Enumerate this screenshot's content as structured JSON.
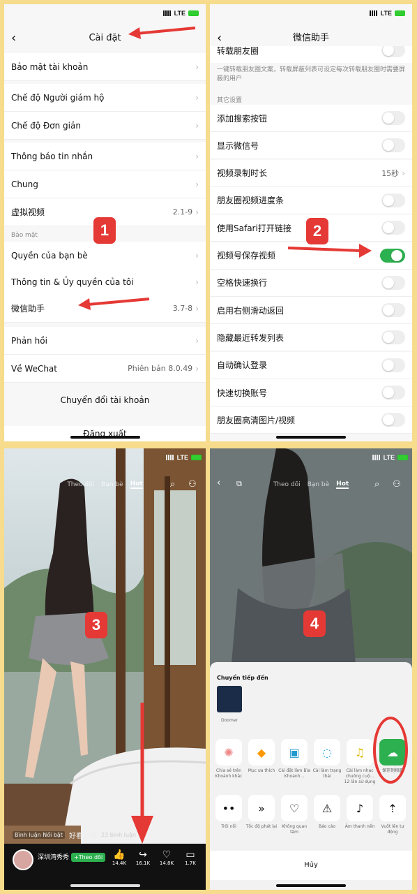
{
  "status": {
    "network": "LTE"
  },
  "panel1": {
    "title": "Cài đặt",
    "rows": [
      {
        "label": "Bảo mật tài khoản",
        "value": ""
      },
      {
        "label": "Chế độ Người giám hộ",
        "value": ""
      },
      {
        "label": "Chế độ Đơn giản",
        "value": ""
      },
      {
        "label": "Thông báo tin nhắn",
        "value": ""
      },
      {
        "label": "Chung",
        "value": ""
      },
      {
        "label": "虚拟视频",
        "value": "2.1-9"
      }
    ],
    "section": "Bảo mật",
    "rows2": [
      {
        "label": "Quyền của bạn bè",
        "value": ""
      },
      {
        "label": "Thông tin & Ủy quyền của tôi",
        "value": ""
      },
      {
        "label": "微信助手",
        "value": "3.7-8"
      },
      {
        "label": "Phản hồi",
        "value": ""
      },
      {
        "label": "Về WeChat",
        "value": "Phiên bản 8.0.49"
      }
    ],
    "switch_account": "Chuyển đổi tài khoản",
    "logout": "Đăng xuất",
    "badge": "1"
  },
  "panel2": {
    "title": "微信助手",
    "partial_row": "转载朋友圈",
    "desc": "一键转载朋友圈文案，转载屏蔽列表可设定每次转载朋友圈时需要屏蔽的用户",
    "section": "其它设置",
    "rows": [
      {
        "label": "添加搜索按钮",
        "value": "",
        "toggle": "off"
      },
      {
        "label": "显示微信号",
        "value": "",
        "toggle": "off"
      },
      {
        "label": "视频录制时长",
        "value": "15秒",
        "toggle": ""
      },
      {
        "label": "朋友圈视频进度条",
        "value": "",
        "toggle": "off"
      },
      {
        "label": "使用Safari打开链接",
        "value": "",
        "toggle": "off"
      },
      {
        "label": "视频号保存视频",
        "value": "",
        "toggle": "on"
      },
      {
        "label": "空格快速换行",
        "value": "",
        "toggle": "off"
      },
      {
        "label": "启用右侧滑动返回",
        "value": "",
        "toggle": "off"
      },
      {
        "label": "隐藏最近转发列表",
        "value": "",
        "toggle": "off"
      },
      {
        "label": "自动确认登录",
        "value": "",
        "toggle": "off"
      },
      {
        "label": "快速切换账号",
        "value": "",
        "toggle": "off"
      },
      {
        "label": "朋友圈高清图片/视频",
        "value": "",
        "toggle": "off"
      }
    ],
    "badge": "2"
  },
  "panel3": {
    "tabs": [
      "Theo dõi",
      "Bạn bè",
      "Hot"
    ],
    "comment_tag": "Bình luận Nổi bật",
    "comment_text": "好看好看",
    "comments_count": "23 bình luận",
    "author": "深圳湾秀秀",
    "follow": "+Theo dõi",
    "stats": [
      "14.4K",
      "16.1K",
      "14.8K",
      "1.7K"
    ],
    "badge": "3"
  },
  "panel4": {
    "tabs": [
      "Theo dõi",
      "Bạn bè",
      "Hot"
    ],
    "forward_to": "Chuyển tiếp đến",
    "contact": "Doomer",
    "row1": [
      "Chia sẻ trên Khoảnh khắc",
      "Mục ưa thích",
      "Cài đặt làm Bìa Khoảnh...",
      "Cài làm trạng thái",
      "Cài làm nhạc chuông cuộ... 12 lần sử dụng",
      "保存到相册"
    ],
    "row2": [
      "Trôi nổi",
      "Tốc độ phát lại",
      "Không quan tâm",
      "Báo cáo",
      "Âm thanh nền",
      "Vuốt lên tự động"
    ],
    "cancel": "Hủy",
    "badge": "4"
  },
  "colors": {
    "accent": "#e53935",
    "toggle_on": "#2db04f",
    "frame": "#f6dc8c"
  }
}
